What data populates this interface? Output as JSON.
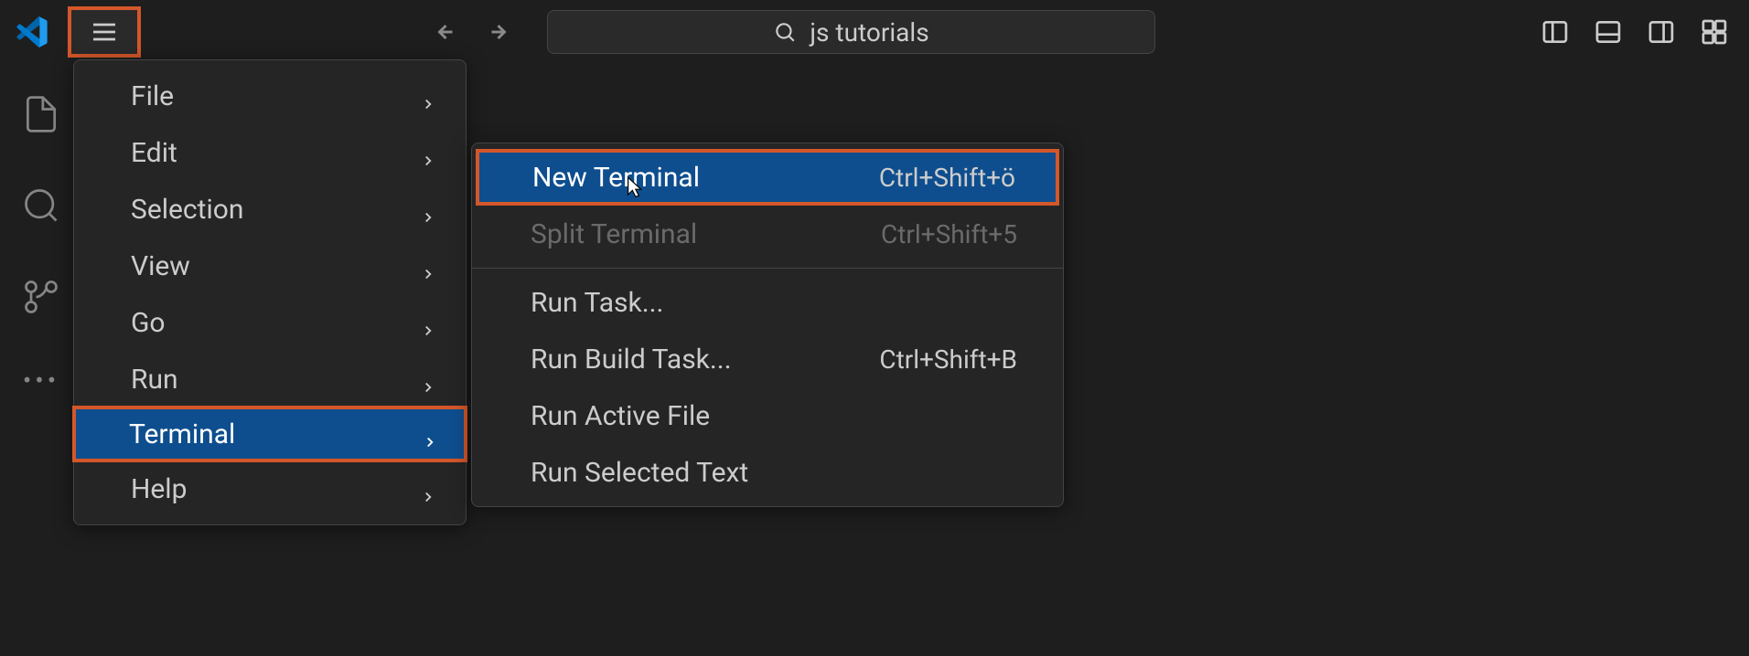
{
  "search": {
    "text": "js tutorials"
  },
  "main_menu": {
    "items": [
      {
        "label": "File",
        "has_submenu": true
      },
      {
        "label": "Edit",
        "has_submenu": true
      },
      {
        "label": "Selection",
        "has_submenu": true
      },
      {
        "label": "View",
        "has_submenu": true
      },
      {
        "label": "Go",
        "has_submenu": true
      },
      {
        "label": "Run",
        "has_submenu": true
      },
      {
        "label": "Terminal",
        "has_submenu": true,
        "highlighted": true
      },
      {
        "label": "Help",
        "has_submenu": true
      }
    ]
  },
  "submenu": {
    "items": [
      {
        "label": "New Terminal",
        "shortcut": "Ctrl+Shift+ö",
        "highlighted": true
      },
      {
        "label": "Split Terminal",
        "shortcut": "Ctrl+Shift+5",
        "disabled": true
      },
      {
        "separator": true
      },
      {
        "label": "Run Task..."
      },
      {
        "label": "Run Build Task...",
        "shortcut": "Ctrl+Shift+B"
      },
      {
        "label": "Run Active File"
      },
      {
        "label": "Run Selected Text"
      }
    ]
  },
  "highlight_color": "#d4572a",
  "selection_bg": "#0e4e8e"
}
